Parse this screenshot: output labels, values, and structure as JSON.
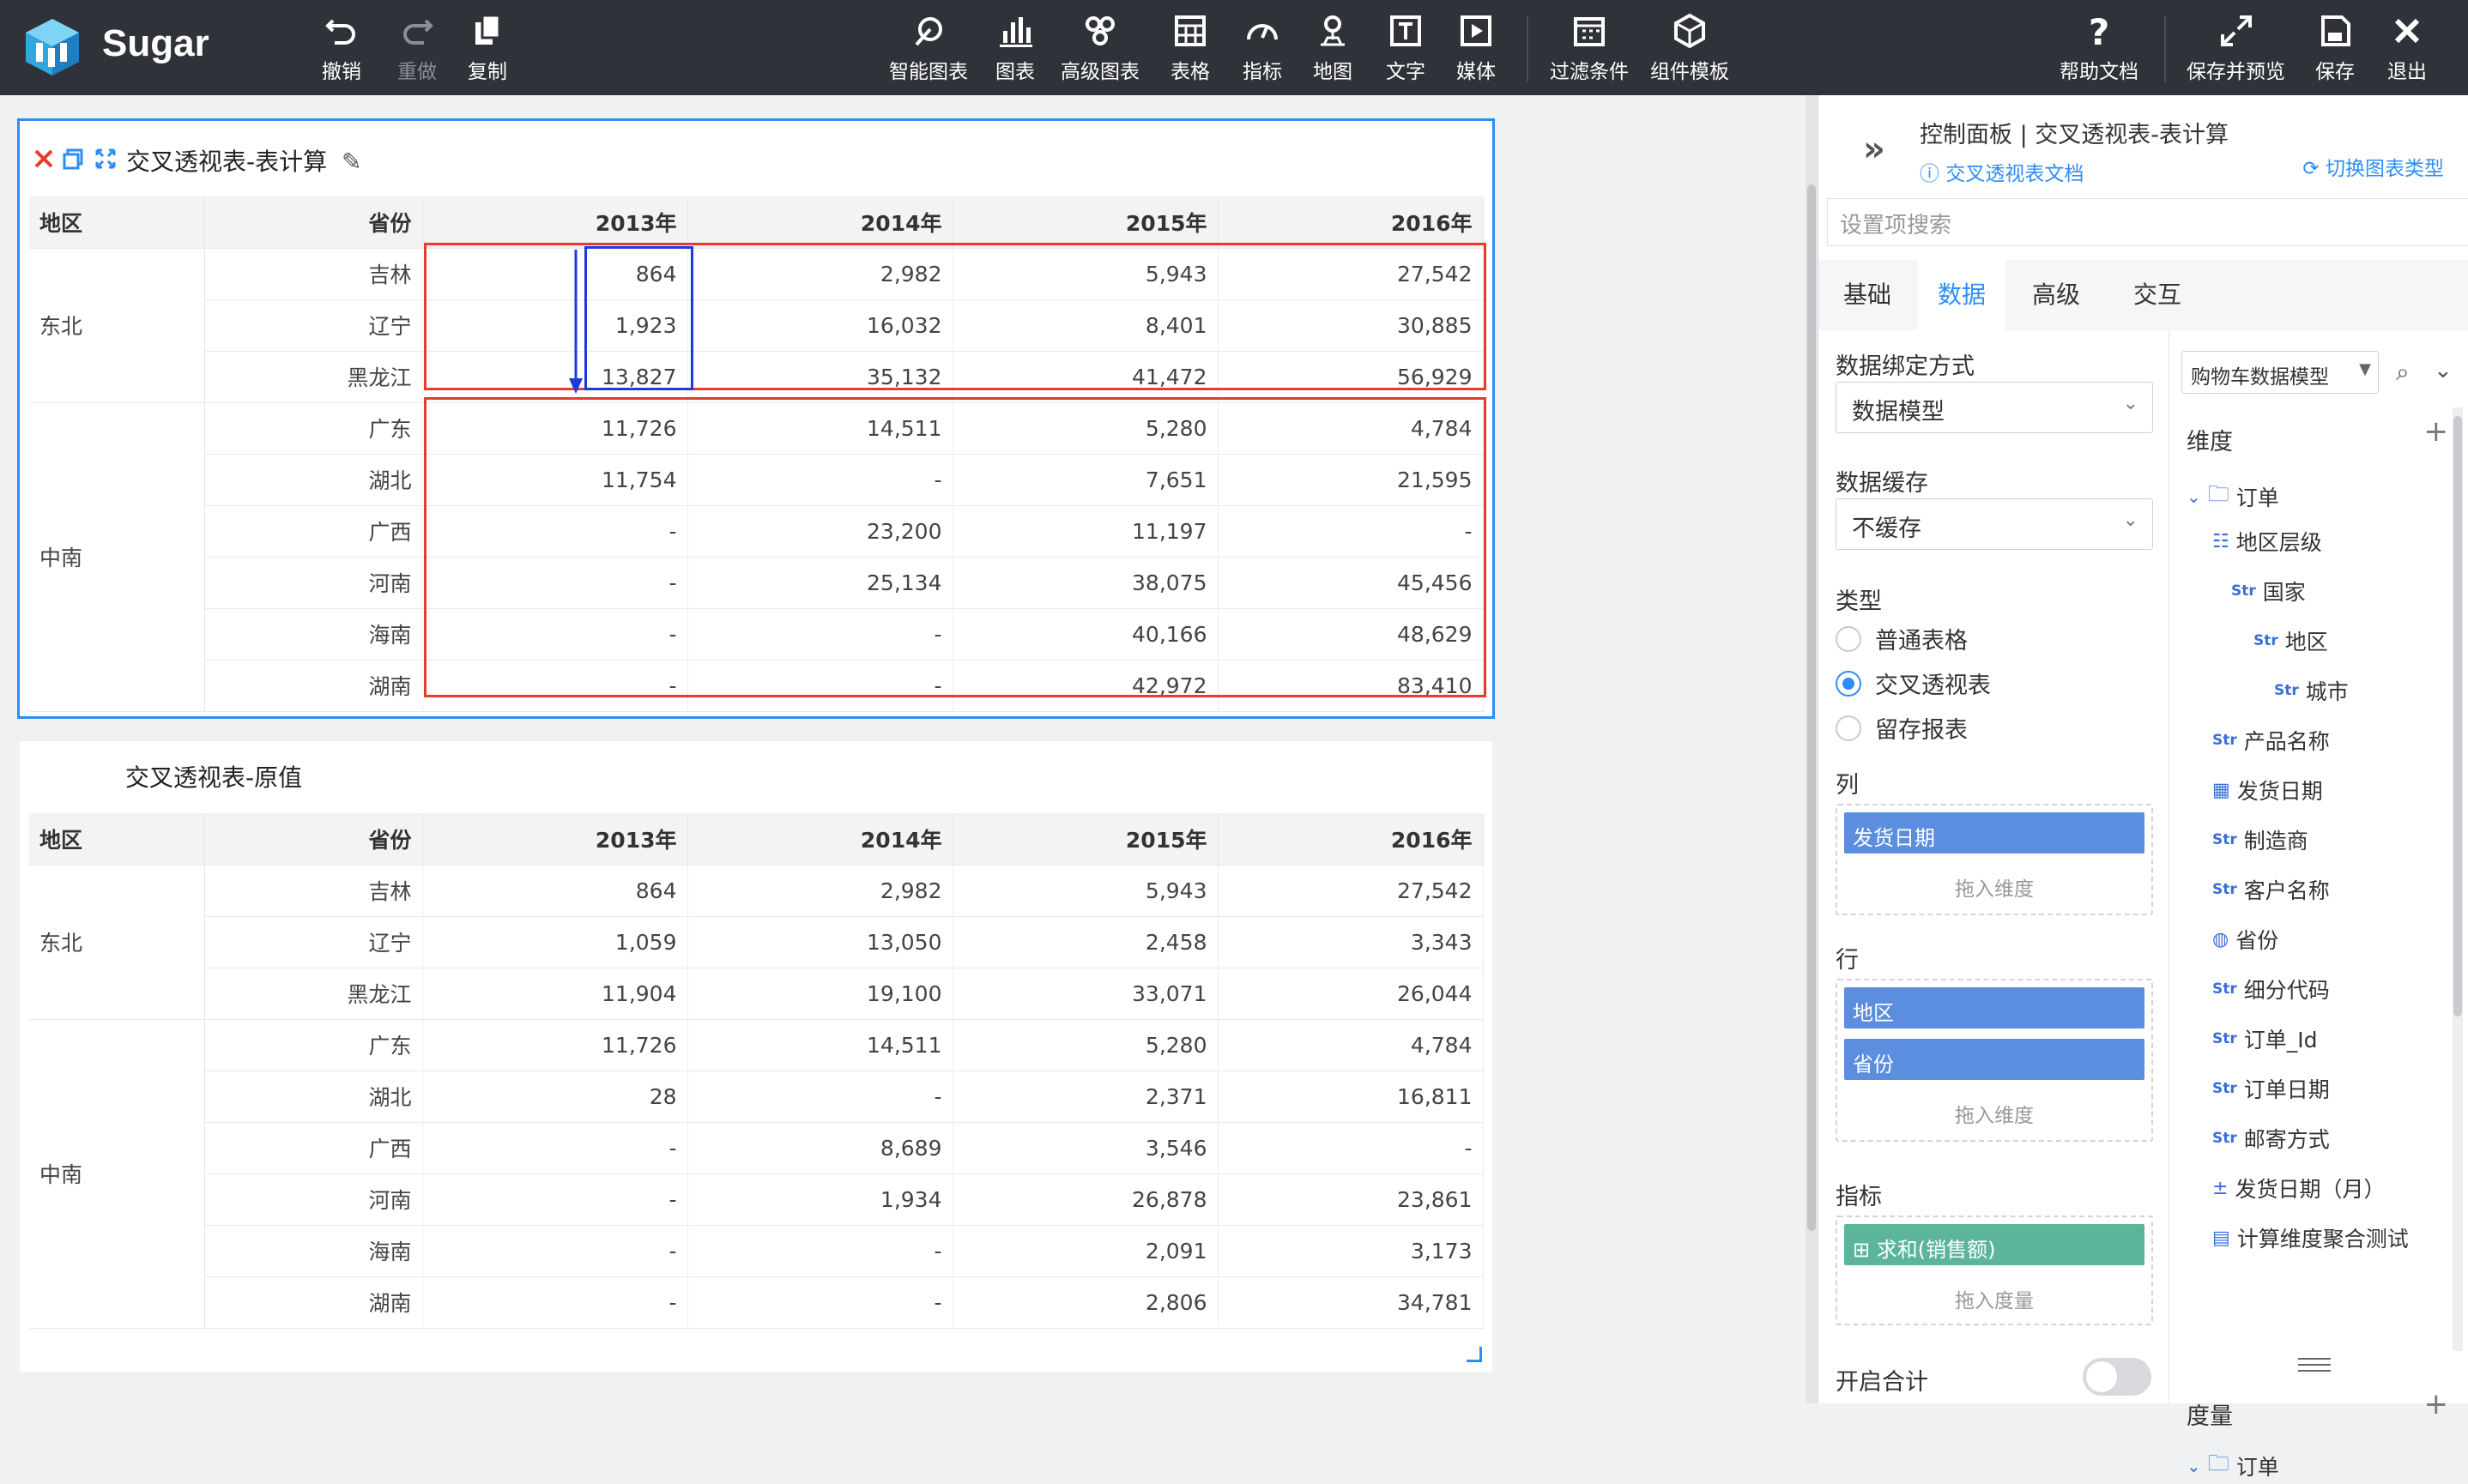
{
  "app": {
    "brand": "Sugar"
  },
  "toolbar": {
    "undo": "撤销",
    "redo": "重做",
    "copy": "复制",
    "smart_chart": "智能图表",
    "chart": "图表",
    "advanced_chart": "高级图表",
    "table": "表格",
    "indicator": "指标",
    "map": "地图",
    "text": "文字",
    "media": "媒体",
    "filter": "过滤条件",
    "component_template": "组件模板",
    "help": "帮助文档",
    "save_preview": "保存并预览",
    "save": "保存",
    "exit": "退出"
  },
  "widget1": {
    "title": "交叉透视表-表计算",
    "headers": [
      "地区",
      "省份",
      "2013年",
      "2014年",
      "2015年",
      "2016年"
    ],
    "groups": [
      {
        "region": "东北",
        "rows": [
          {
            "province": "吉林",
            "values": [
              "864",
              "2,982",
              "5,943",
              "27,542"
            ]
          },
          {
            "province": "辽宁",
            "values": [
              "1,923",
              "16,032",
              "8,401",
              "30,885"
            ]
          },
          {
            "province": "黑龙江",
            "values": [
              "13,827",
              "35,132",
              "41,472",
              "56,929"
            ]
          }
        ]
      },
      {
        "region": "中南",
        "rows": [
          {
            "province": "广东",
            "values": [
              "11,726",
              "14,511",
              "5,280",
              "4,784"
            ]
          },
          {
            "province": "湖北",
            "values": [
              "11,754",
              "-",
              "7,651",
              "21,595"
            ]
          },
          {
            "province": "广西",
            "values": [
              "-",
              "23,200",
              "11,197",
              "-"
            ]
          },
          {
            "province": "河南",
            "values": [
              "-",
              "25,134",
              "38,075",
              "45,456"
            ]
          },
          {
            "province": "海南",
            "values": [
              "-",
              "-",
              "40,166",
              "48,629"
            ]
          },
          {
            "province": "湖南",
            "values": [
              "-",
              "-",
              "42,972",
              "83,410"
            ]
          }
        ]
      }
    ]
  },
  "widget2": {
    "title": "交叉透视表-原值",
    "headers": [
      "地区",
      "省份",
      "2013年",
      "2014年",
      "2015年",
      "2016年"
    ],
    "groups": [
      {
        "region": "东北",
        "rows": [
          {
            "province": "吉林",
            "values": [
              "864",
              "2,982",
              "5,943",
              "27,542"
            ]
          },
          {
            "province": "辽宁",
            "values": [
              "1,059",
              "13,050",
              "2,458",
              "3,343"
            ]
          },
          {
            "province": "黑龙江",
            "values": [
              "11,904",
              "19,100",
              "33,071",
              "26,044"
            ]
          }
        ]
      },
      {
        "region": "中南",
        "rows": [
          {
            "province": "广东",
            "values": [
              "11,726",
              "14,511",
              "5,280",
              "4,784"
            ]
          },
          {
            "province": "湖北",
            "values": [
              "28",
              "-",
              "2,371",
              "16,811"
            ]
          },
          {
            "province": "广西",
            "values": [
              "-",
              "8,689",
              "3,546",
              "-"
            ]
          },
          {
            "province": "河南",
            "values": [
              "-",
              "1,934",
              "26,878",
              "23,861"
            ]
          },
          {
            "province": "海南",
            "values": [
              "-",
              "-",
              "2,091",
              "3,173"
            ]
          },
          {
            "province": "湖南",
            "values": [
              "-",
              "-",
              "2,806",
              "34,781"
            ]
          }
        ]
      }
    ]
  },
  "panel": {
    "title": "控制面板 | 交叉透视表-表计算",
    "doc_link": "交叉透视表文档",
    "switch_type": "切换图表类型",
    "search_placeholder": "设置项搜索",
    "tabs": [
      "基础",
      "数据",
      "高级",
      "交互"
    ],
    "active_tab": "数据",
    "binding_label": "数据绑定方式",
    "binding_value": "数据模型",
    "cache_label": "数据缓存",
    "cache_value": "不缓存",
    "type_label": "类型",
    "types": [
      "普通表格",
      "交叉透视表",
      "留存报表"
    ],
    "selected_type": "交叉透视表",
    "columns_label": "列",
    "columns_chips": [
      "发货日期"
    ],
    "drop_dimension": "拖入维度",
    "rows_label": "行",
    "rows_chips": [
      "地区",
      "省份"
    ],
    "measures_label": "指标",
    "measure_chips": [
      "求和(销售额)"
    ],
    "drop_measure": "拖入度量",
    "total_label": "开启合计",
    "model_select": "购物车数据模型",
    "dimensions_label": "维度",
    "measures_header": "度量",
    "folder": "订单",
    "fields": [
      {
        "type": "hier",
        "name": "地区层级"
      },
      {
        "type": "Str",
        "name": "国家"
      },
      {
        "type": "Str",
        "name": "地区"
      },
      {
        "type": "Str",
        "name": "城市"
      },
      {
        "type": "Str",
        "name": "产品名称"
      },
      {
        "type": "date",
        "name": "发货日期"
      },
      {
        "type": "Str",
        "name": "制造商"
      },
      {
        "type": "Str",
        "name": "客户名称"
      },
      {
        "type": "geo",
        "name": "省份"
      },
      {
        "type": "Str",
        "name": "细分代码"
      },
      {
        "type": "Str",
        "name": "订单_Id"
      },
      {
        "type": "Str",
        "name": "订单日期"
      },
      {
        "type": "Str",
        "name": "邮寄方式"
      },
      {
        "type": "calc",
        "name": "发货日期（月）"
      },
      {
        "type": "calc2",
        "name": "计算维度聚合测试"
      }
    ],
    "measures_folder": "订单"
  }
}
